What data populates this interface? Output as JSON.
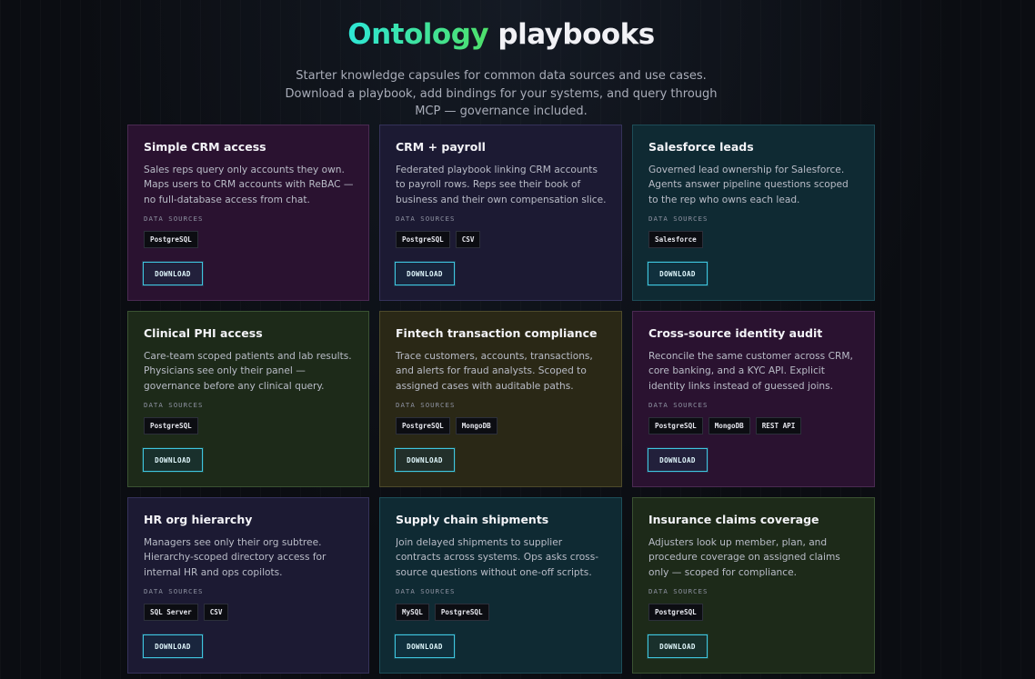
{
  "hero": {
    "title_accent": "Ontology",
    "title_rest": " playbooks",
    "subtitle": "Starter knowledge capsules for common data sources and use cases. Download a playbook, add bindings for your systems, and query through MCP — governance included."
  },
  "labels": {
    "data_sources": "DATA SOURCES",
    "download": "DOWNLOAD"
  },
  "colors": {
    "accent_gradient_start": "#2ee6d6",
    "accent_gradient_end": "#4ee06a",
    "button_border": "#3fc6e0"
  },
  "cards": [
    {
      "title": "Simple CRM access",
      "description": "Sales reps query only accounts they own. Maps users to CRM accounts with ReBAC — no full-database access from chat.",
      "sources": [
        "PostgreSQL"
      ],
      "tint": "magenta"
    },
    {
      "title": "CRM + payroll",
      "description": "Federated playbook linking CRM accounts to payroll rows. Reps see their book of business and their own compensation slice.",
      "sources": [
        "PostgreSQL",
        "CSV"
      ],
      "tint": "indigo"
    },
    {
      "title": "Salesforce leads",
      "description": "Governed lead ownership for Salesforce. Agents answer pipeline questions scoped to the rep who owns each lead.",
      "sources": [
        "Salesforce"
      ],
      "tint": "teal"
    },
    {
      "title": "Clinical PHI access",
      "description": "Care-team scoped patients and lab results. Physicians see only their panel — governance before any clinical query.",
      "sources": [
        "PostgreSQL"
      ],
      "tint": "olive"
    },
    {
      "title": "Fintech transaction compliance",
      "description": "Trace customers, accounts, transactions, and alerts for fraud analysts. Scoped to assigned cases with auditable paths.",
      "sources": [
        "PostgreSQL",
        "MongoDB"
      ],
      "tint": "mustard"
    },
    {
      "title": "Cross-source identity audit",
      "description": "Reconcile the same customer across CRM, core banking, and a KYC API. Explicit identity links instead of guessed joins.",
      "sources": [
        "PostgreSQL",
        "MongoDB",
        "REST API"
      ],
      "tint": "magenta"
    },
    {
      "title": "HR org hierarchy",
      "description": "Managers see only their org subtree. Hierarchy-scoped directory access for internal HR and ops copilots.",
      "sources": [
        "SQL Server",
        "CSV"
      ],
      "tint": "indigo"
    },
    {
      "title": "Supply chain shipments",
      "description": "Join delayed shipments to supplier contracts across systems. Ops asks cross-source questions without one-off scripts.",
      "sources": [
        "MySQL",
        "PostgreSQL"
      ],
      "tint": "teal"
    },
    {
      "title": "Insurance claims coverage",
      "description": "Adjusters look up member, plan, and procedure coverage on assigned claims only — scoped for compliance.",
      "sources": [
        "PostgreSQL"
      ],
      "tint": "olive"
    }
  ]
}
